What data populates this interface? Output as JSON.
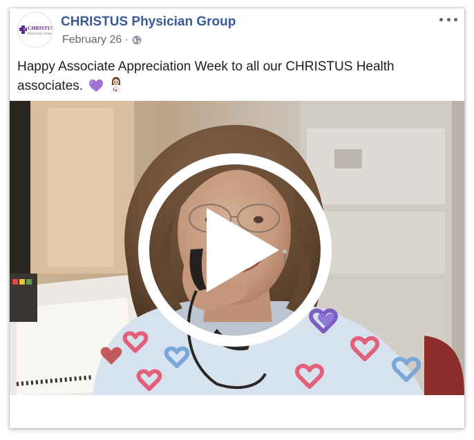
{
  "post": {
    "page_name": "CHRISTUS Physician Group",
    "date": "February 26",
    "separator": "·",
    "audience_icon": "globe-icon",
    "more_icon": "more-options-icon",
    "text": "Happy Associate Appreciation Week to all our CHRISTUS Health associates.",
    "emojis": [
      "purple-heart-emoji",
      "woman-health-worker-emoji"
    ]
  },
  "avatar": {
    "logo_line1": "CHRISTUS",
    "logo_line2": "Physician Group",
    "brand_color": "#5b2d82"
  },
  "video": {
    "play_icon": "play-icon",
    "subject": "woman in heart-print scrubs on telephone"
  },
  "colors": {
    "link": "#385898",
    "meta": "#616770",
    "text": "#1c1e21"
  }
}
